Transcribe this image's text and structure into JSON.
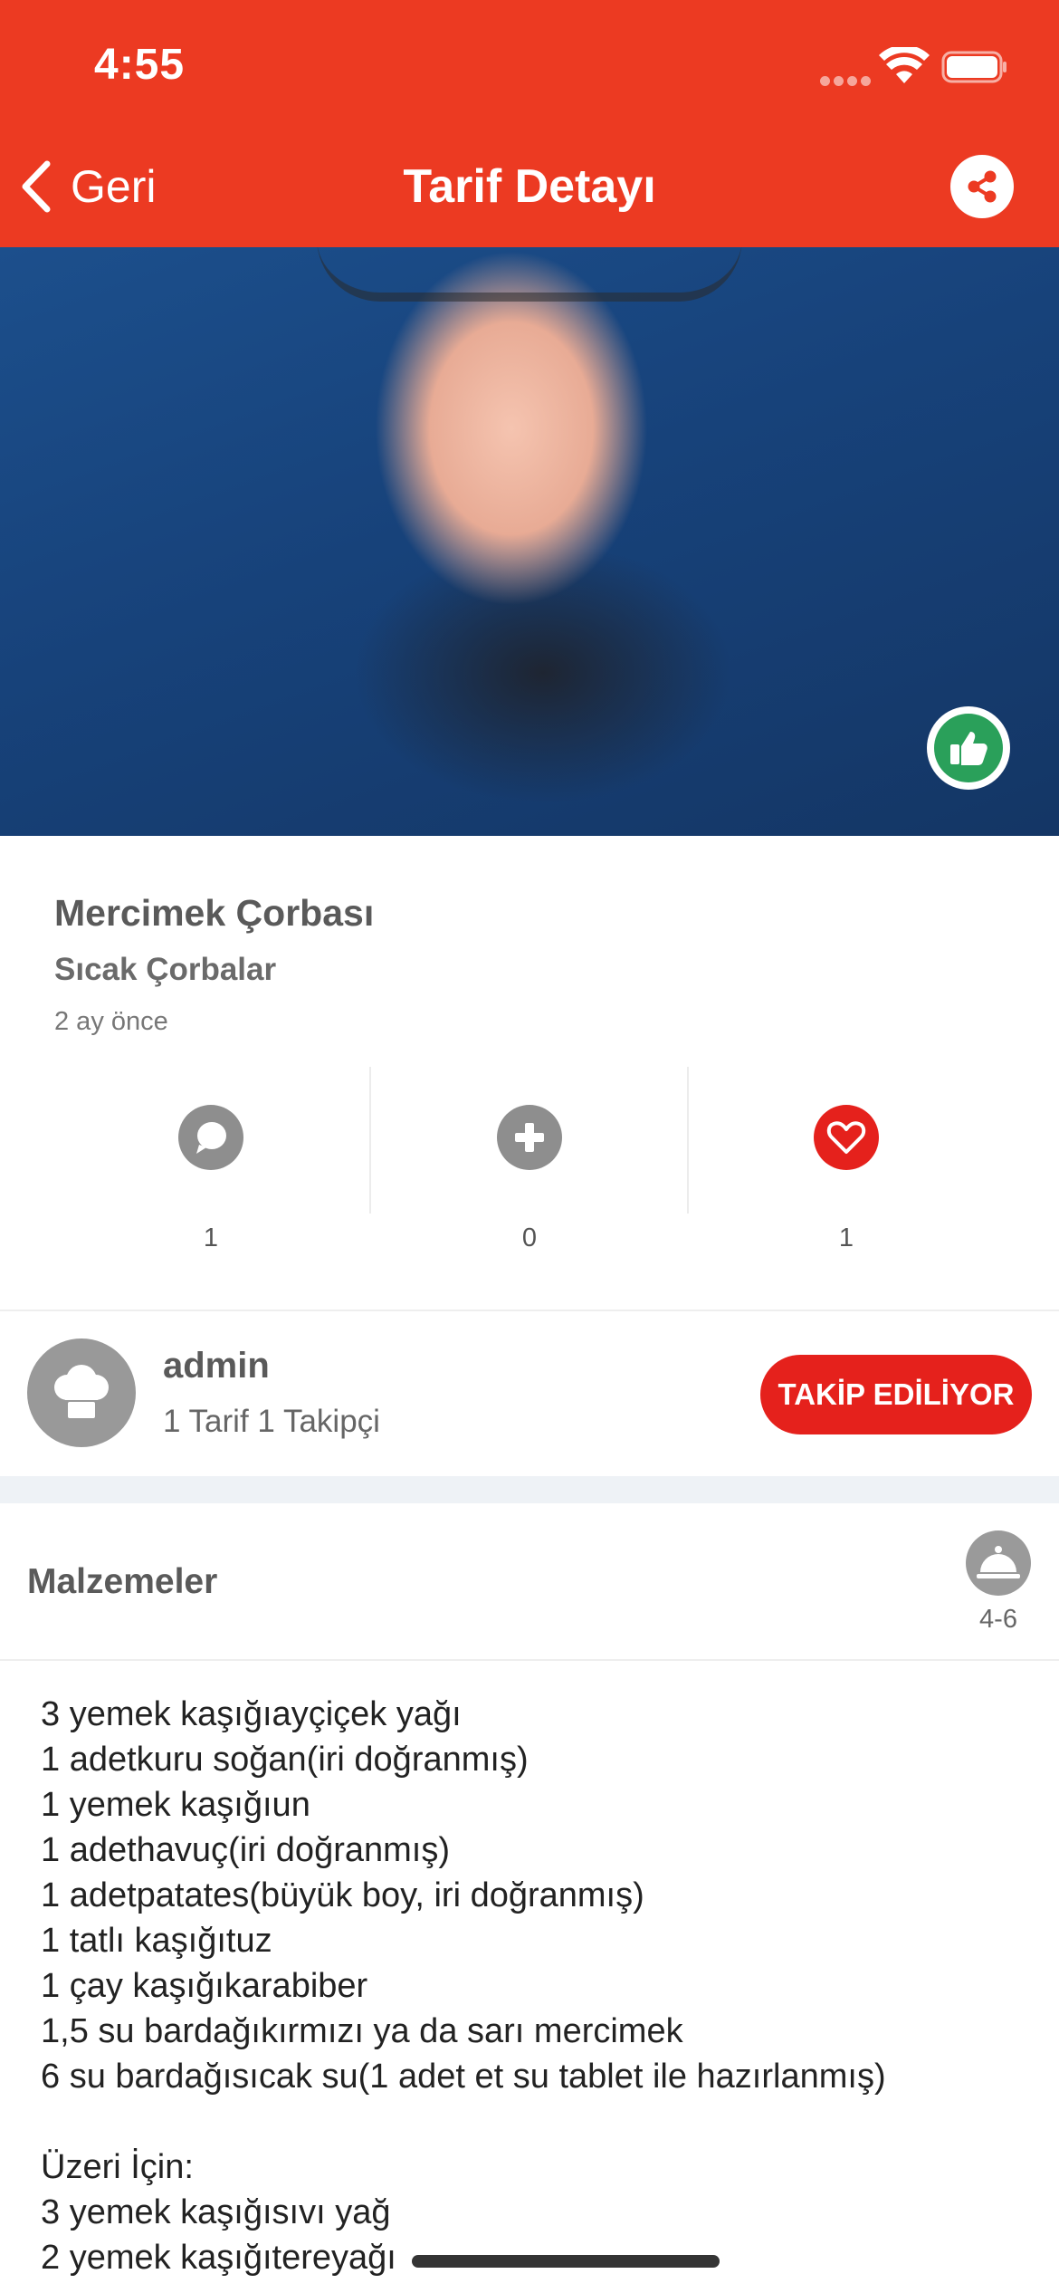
{
  "status_bar": {
    "time": "4:55"
  },
  "nav": {
    "back_label": "Geri",
    "title": "Tarif Detayı"
  },
  "recipe": {
    "title": "Mercimek Çorbası",
    "category": "Sıcak Çorbalar",
    "time_ago": "2 ay önce"
  },
  "stats": {
    "comments": "1",
    "adds": "0",
    "likes": "1"
  },
  "author": {
    "name": "admin",
    "stats": "1 Tarif 1 Takipçi",
    "follow_label": "TAKİP EDİLİYOR"
  },
  "ingredients": {
    "title": "Malzemeler",
    "servings": "4-6",
    "lines": [
      "3 yemek kaşığıayçiçek yağı",
      "1 adetkuru soğan(iri doğranmış)",
      "1 yemek kaşığıun",
      "1 adethavuç(iri doğranmış)",
      "1 adetpatates(büyük boy, iri doğranmış)",
      "1 tatlı kaşığıtuz",
      "1 çay kaşığıkarabiber",
      "1,5 su bardağıkırmızı ya da sarı mercimek",
      "6 su bardağısıcak su(1 adet et su tablet ile hazırlanmış)",
      "",
      "Üzeri İçin:",
      "3 yemek kaşığısıvı yağ",
      "2 yemek kaşığıtereyağı"
    ]
  },
  "colors": {
    "header": "#ec3a22",
    "follow_button": "#e5211c",
    "like_icon": "#e5211c",
    "approved_badge": "#2aa05a"
  }
}
